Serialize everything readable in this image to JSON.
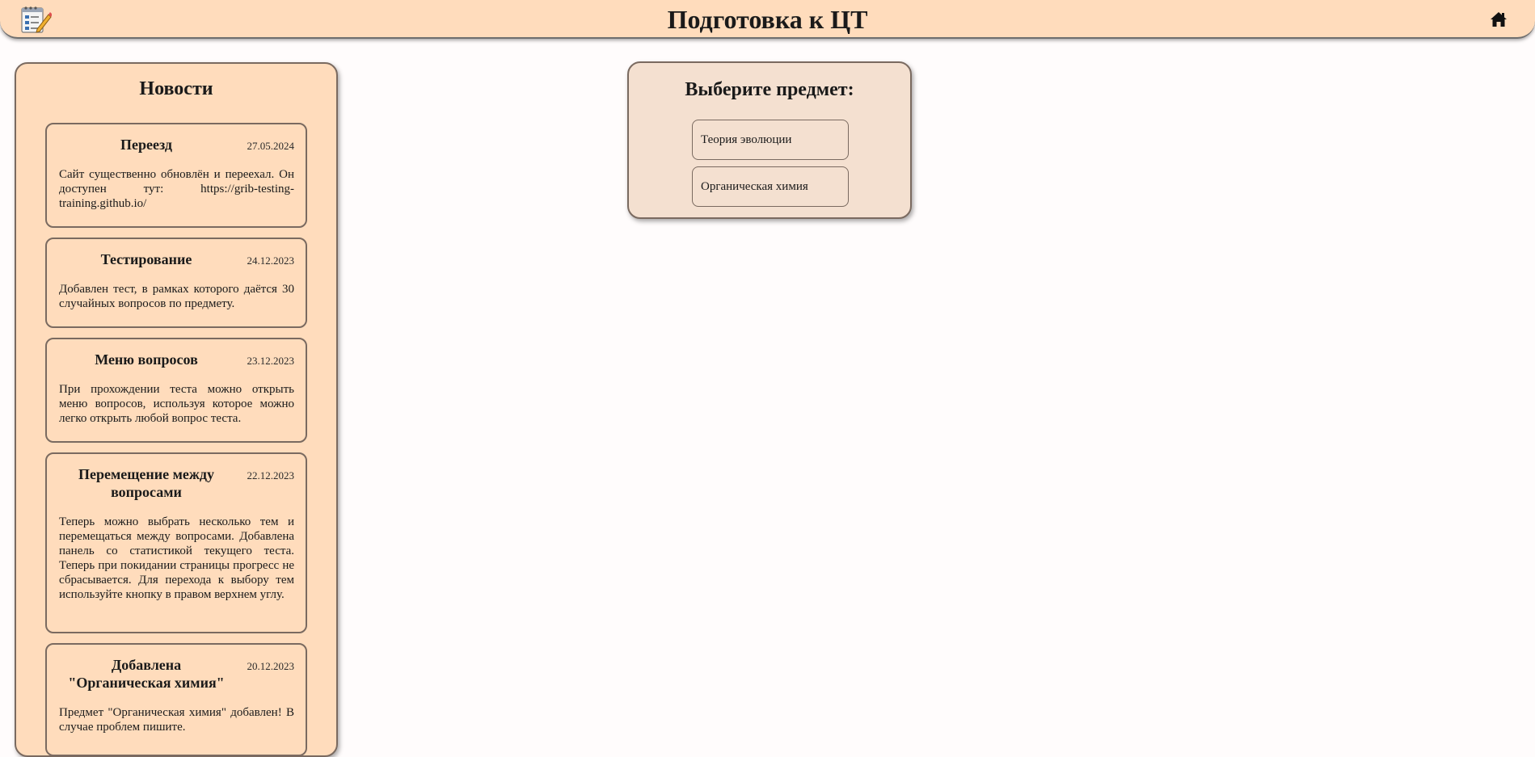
{
  "header": {
    "title": "Подготовка к ЦТ",
    "logo_icon": "notepad-pencil-icon",
    "home_icon": "home-icon"
  },
  "news": {
    "title": "Новости",
    "items": [
      {
        "title": "Переезд",
        "date": "27.05.2024",
        "text": "Сайт существенно обновлён и переехал. Он доступен тут: https://grib-testing-training.github.io/"
      },
      {
        "title": "Тестирование",
        "date": "24.12.2023",
        "text": "Добавлен тест, в рамках которого даётся 30 случайных вопросов по предмету."
      },
      {
        "title": "Меню вопросов",
        "date": "23.12.2023",
        "text": "При прохождении теста можно открыть меню вопросов, используя которое можно легко открыть любой вопрос теста."
      },
      {
        "title": "Перемещение между вопросами",
        "date": "22.12.2023",
        "text": "Теперь можно выбрать несколько тем и перемещаться между вопросами. Добавлена панель со статистикой текущего теста. Теперь при покидании страницы прогресс не сбрасывается. Для перехода к выбору тем используйте кнопку в правом верхнем углу."
      },
      {
        "title": "Добавлена \"Органическая химия\"",
        "date": "20.12.2023",
        "text": "Предмет \"Органическая химия\" добавлен! В случае проблем пишите."
      }
    ]
  },
  "subjects": {
    "title": "Выберите предмет:",
    "items": [
      {
        "label": "Теория эволюции"
      },
      {
        "label": "Органическая химия"
      }
    ]
  },
  "colors": {
    "header_bg": "#ffdcbc",
    "panel_bg": "#ffdcbc",
    "subject_panel_bg": "#f4e0d0",
    "border": "#7a6a60",
    "page_bg": "#fffcfc"
  }
}
